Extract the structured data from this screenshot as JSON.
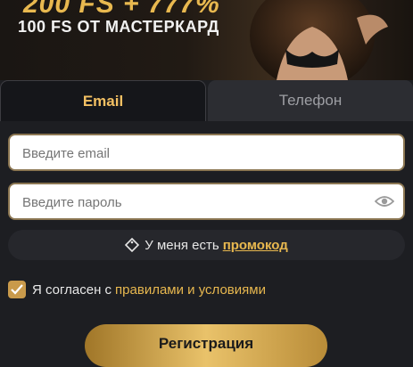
{
  "banner": {
    "headline": "200 FS + 777%",
    "subline": "100 FS ОТ МАСТЕРКАРД"
  },
  "tabs": {
    "email_label": "Email",
    "phone_label": "Телефон",
    "active": "email"
  },
  "form": {
    "email_placeholder": "Введите email",
    "email_value": "",
    "password_placeholder": "Введите пароль",
    "password_value": ""
  },
  "promo": {
    "text": "У меня есть",
    "link": "промокод"
  },
  "agreement": {
    "checked": true,
    "text": "Я согласен с",
    "link": "правилами и условиями"
  },
  "actions": {
    "register_label": "Регистрация"
  },
  "colors": {
    "accent": "#e8b84f",
    "background": "#1d1e22",
    "field_border": "#8b7652"
  },
  "icons": [
    "tag-icon",
    "eye-icon",
    "check-icon"
  ]
}
